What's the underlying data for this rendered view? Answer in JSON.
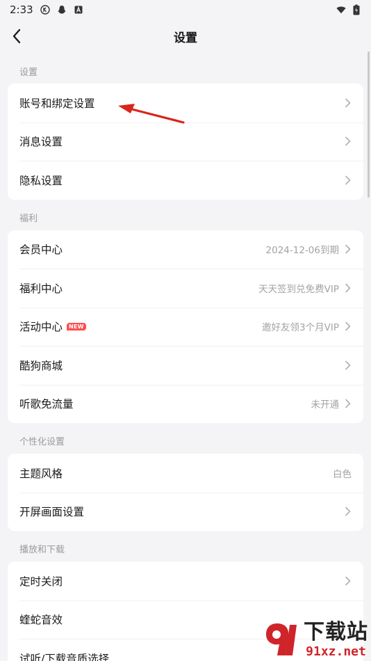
{
  "status_bar": {
    "time": "2:33",
    "icons": [
      "k-app-icon",
      "penguin-icon",
      "a-app-icon"
    ],
    "right_icons": [
      "wifi-icon",
      "battery-charging-icon"
    ]
  },
  "header": {
    "title": "设置",
    "back_icon": "chevron-left-icon"
  },
  "sections": [
    {
      "title": "设置",
      "items": [
        {
          "label": "账号和绑定设置",
          "value": "",
          "chevron": true
        },
        {
          "label": "消息设置",
          "value": "",
          "chevron": true
        },
        {
          "label": "隐私设置",
          "value": "",
          "chevron": true
        }
      ]
    },
    {
      "title": "福利",
      "items": [
        {
          "label": "会员中心",
          "value": "2024-12-06到期",
          "chevron": true
        },
        {
          "label": "福利中心",
          "value": "天天签到兑免费VIP",
          "chevron": true
        },
        {
          "label": "活动中心",
          "value": "邀好友领3个月VIP",
          "chevron": true,
          "badge": "NEW"
        },
        {
          "label": "酷狗商城",
          "value": "",
          "chevron": true
        },
        {
          "label": "听歌免流量",
          "value": "未开通",
          "chevron": true
        }
      ]
    },
    {
      "title": "个性化设置",
      "items": [
        {
          "label": "主题风格",
          "value": "白色",
          "chevron": false
        },
        {
          "label": "开屏画面设置",
          "value": "",
          "chevron": true
        }
      ]
    },
    {
      "title": "播放和下载",
      "items": [
        {
          "label": "定时关闭",
          "value": "",
          "chevron": true
        },
        {
          "label": "蝰蛇音效",
          "value": "",
          "chevron": false
        },
        {
          "label": "试听/下载音质选择",
          "value": "",
          "chevron": false
        }
      ]
    }
  ],
  "watermark": {
    "title": "下载站",
    "url": "91xz.net"
  },
  "colors": {
    "background": "#f4f4f6",
    "card": "#ffffff",
    "badge": "#ff4d4f",
    "annotation_arrow": "#d9261c"
  }
}
